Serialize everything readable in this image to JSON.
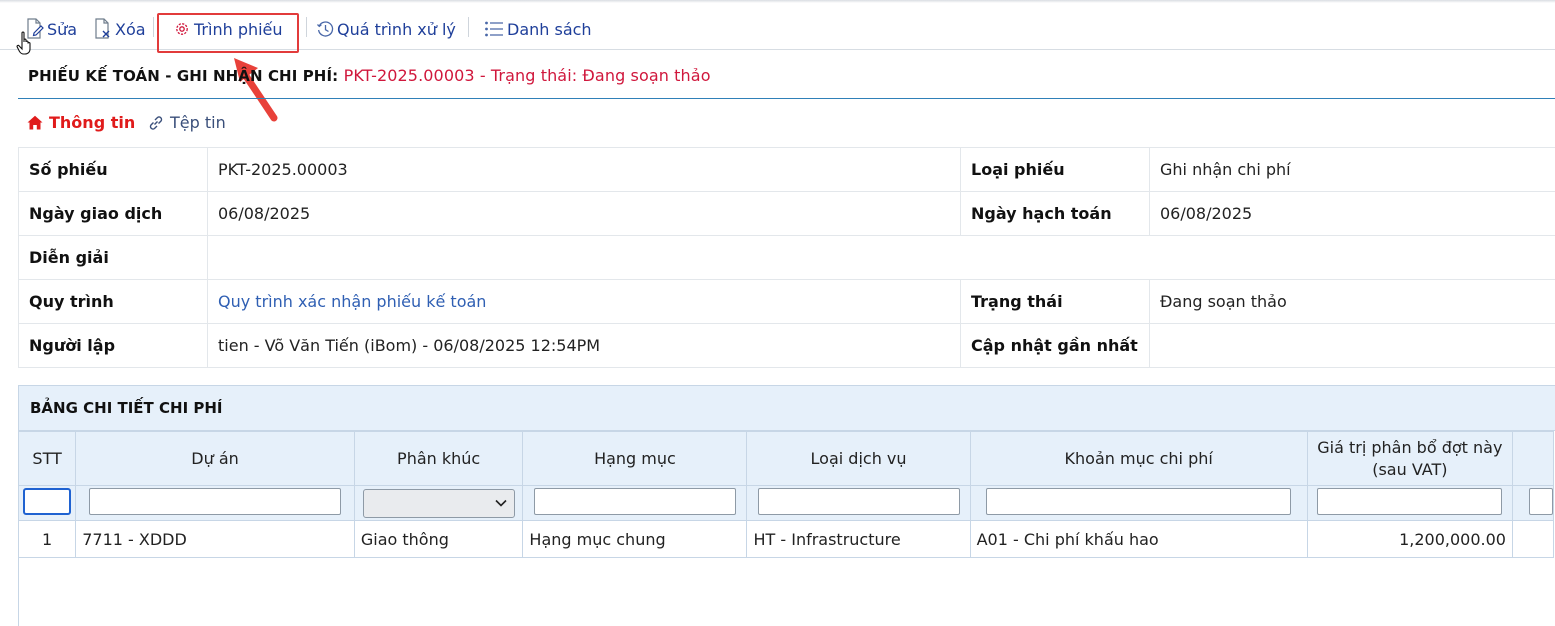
{
  "toolbar": {
    "edit_label": "Sửa",
    "delete_label": "Xóa",
    "submit_label": "Trình phiếu",
    "history_label": "Quá trình xử lý",
    "list_label": "Danh sách"
  },
  "header": {
    "title_prefix": "PHIẾU KẾ TOÁN - GHI NHẬN CHI PHÍ:",
    "title_suffix": "PKT-2025.00003 - Trạng thái: Đang soạn thảo"
  },
  "tabs": {
    "info": "Thông tin",
    "files": "Tệp tin"
  },
  "info": {
    "so_phieu_label": "Số phiếu",
    "so_phieu": "PKT-2025.00003",
    "loai_phieu_label": "Loại phiếu",
    "loai_phieu": "Ghi nhận chi phí",
    "ngay_gd_label": "Ngày giao dịch",
    "ngay_gd": "06/08/2025",
    "ngay_ht_label": "Ngày hạch toán",
    "ngay_ht": "06/08/2025",
    "dien_giai_label": "Diễn giải",
    "dien_giai": "",
    "quy_trinh_label": "Quy trình",
    "quy_trinh": "Quy trình xác nhận phiếu kế toán",
    "trang_thai_label": "Trạng thái",
    "trang_thai": "Đang soạn thảo",
    "nguoi_lap_label": "Người lập",
    "nguoi_lap": "tien - Võ Văn Tiến (iBom) - 06/08/2025 12:54PM",
    "cap_nhat_label": "Cập nhật gần nhất",
    "cap_nhat": ""
  },
  "detail": {
    "title": "BẢNG CHI TIẾT CHI PHÍ",
    "columns": {
      "stt": "STT",
      "du_an": "Dự án",
      "phan_khuc": "Phân khúc",
      "hang_muc": "Hạng mục",
      "loai_dv": "Loại dịch vụ",
      "khoan_muc": "Khoản mục chi phí",
      "gia_tri_1": "Giá trị phân bổ đợt này",
      "gia_tri_2": "(sau VAT)"
    },
    "rows": [
      {
        "stt": "1",
        "du_an": "7711 - XDDD",
        "phan_khuc": "Giao thông",
        "hang_muc": "Hạng mục chung",
        "loai_dv": "HT - Infrastructure",
        "khoan_muc": "A01 - Chi phí khấu hao",
        "gia_tri": "1,200,000.00"
      }
    ]
  },
  "colors": {
    "accent_blue": "#1f3f9a",
    "link_blue": "#2f5fb3",
    "status_red": "#d0173c",
    "highlight_red": "#e23b3b",
    "header_bg": "#e6f0fa"
  }
}
